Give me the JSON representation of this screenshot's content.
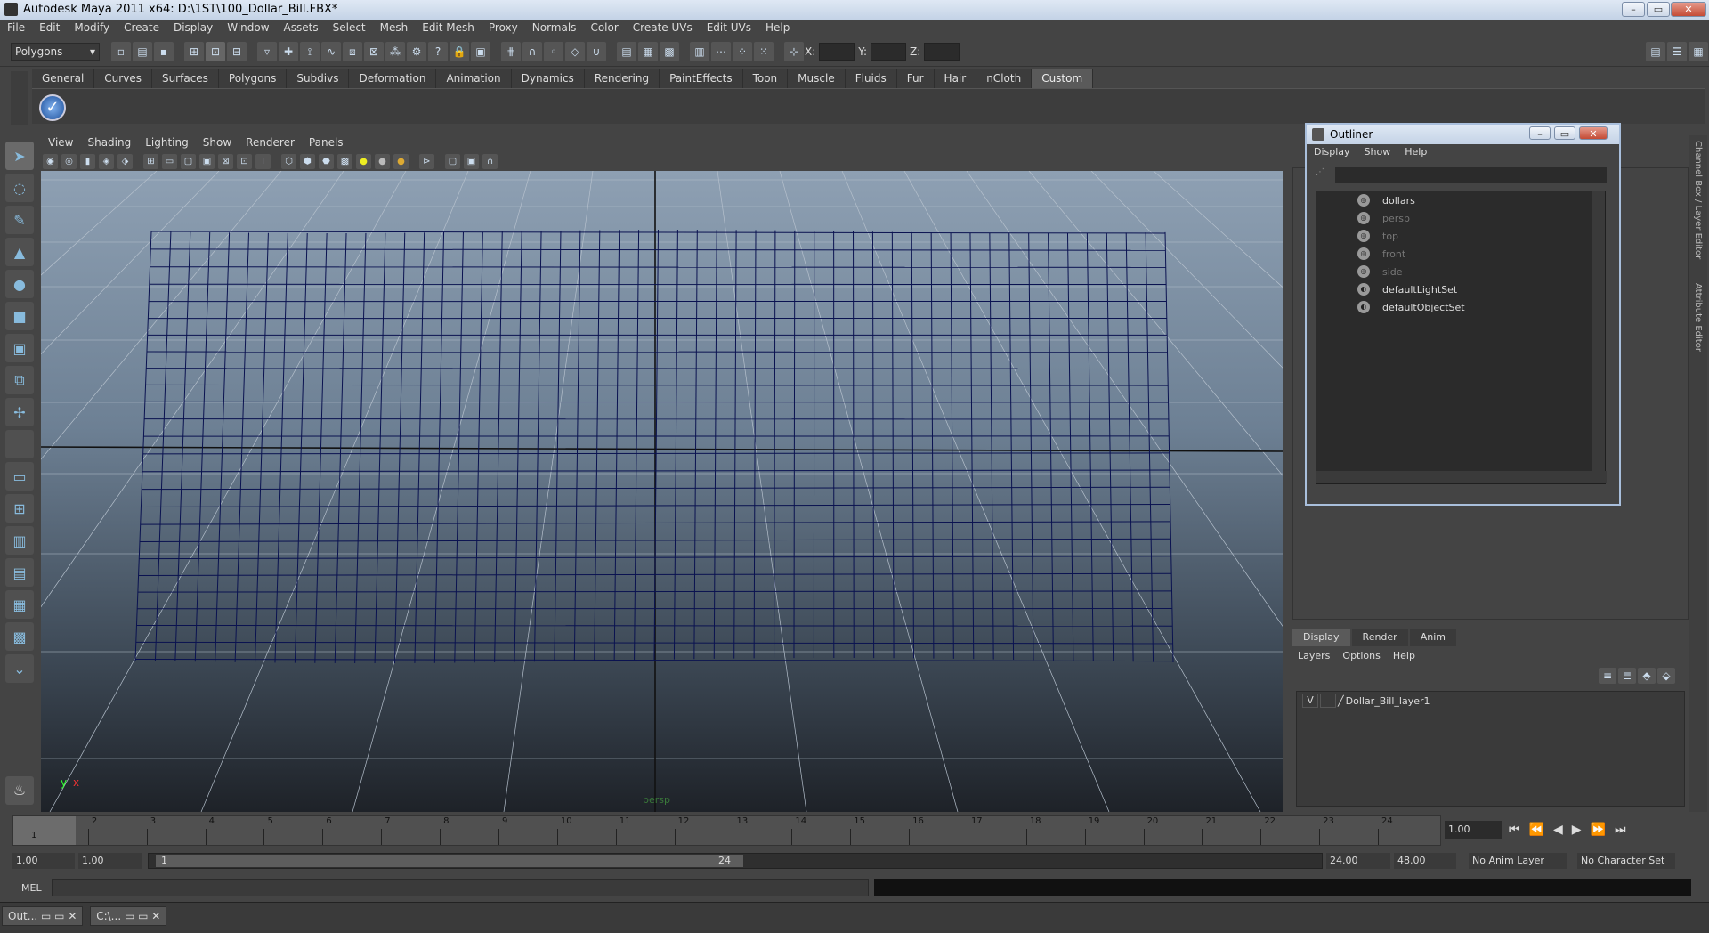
{
  "window": {
    "title": "Autodesk Maya 2011 x64: D:\\1ST\\100_Dollar_Bill.FBX*",
    "min": "–",
    "max": "▭",
    "close": "✕"
  },
  "menu": [
    "File",
    "Edit",
    "Modify",
    "Create",
    "Display",
    "Window",
    "Assets",
    "Select",
    "Mesh",
    "Edit Mesh",
    "Proxy",
    "Normals",
    "Color",
    "Create UVs",
    "Edit UVs",
    "Help"
  ],
  "status": {
    "mode": "Polygons",
    "x_label": "X:",
    "y_label": "Y:",
    "z_label": "Z:"
  },
  "shelf_tabs": [
    "General",
    "Curves",
    "Surfaces",
    "Polygons",
    "Subdivs",
    "Deformation",
    "Animation",
    "Dynamics",
    "Rendering",
    "PaintEffects",
    "Toon",
    "Muscle",
    "Fluids",
    "Fur",
    "Hair",
    "nCloth",
    "Custom"
  ],
  "shelf_active": "Custom",
  "viewport": {
    "menu": [
      "View",
      "Shading",
      "Lighting",
      "Show",
      "Renderer",
      "Panels"
    ],
    "camera": "persp",
    "axis_y": "y",
    "axis_x": "x",
    "mesh_color": "#0a1250"
  },
  "outliner": {
    "title": "Outliner",
    "menu": [
      "Display",
      "Show",
      "Help"
    ],
    "items": [
      {
        "name": "dollars",
        "dim": false
      },
      {
        "name": "persp",
        "dim": true
      },
      {
        "name": "top",
        "dim": true
      },
      {
        "name": "front",
        "dim": true
      },
      {
        "name": "side",
        "dim": true
      },
      {
        "name": "defaultLightSet",
        "dim": false
      },
      {
        "name": "defaultObjectSet",
        "dim": false
      }
    ]
  },
  "side_tabs": {
    "channel": "Channel Box / Layer Editor",
    "attr": "Attribute Editor"
  },
  "layers": {
    "tabs": [
      "Display",
      "Render",
      "Anim"
    ],
    "active": "Display",
    "menu": [
      "Layers",
      "Options",
      "Help"
    ],
    "layer_v": "V",
    "layer_name": "Dollar_Bill_layer1"
  },
  "timeline": {
    "ticks": [
      "1",
      "2",
      "3",
      "4",
      "5",
      "6",
      "7",
      "8",
      "9",
      "10",
      "11",
      "12",
      "13",
      "14",
      "15",
      "16",
      "17",
      "18",
      "19",
      "20",
      "21",
      "22",
      "23",
      "24"
    ],
    "current": "1",
    "current_field": "1.00"
  },
  "range": {
    "start": "1.00",
    "start2": "1.00",
    "inner_start": "1",
    "inner_end": "24",
    "end": "24.00",
    "end2": "48.00",
    "anim_layer": "No Anim Layer",
    "char_set": "No Character Set"
  },
  "cmd": {
    "label": "MEL"
  },
  "taskbar": [
    {
      "label": "Out..."
    },
    {
      "label": "C:\\..."
    }
  ]
}
